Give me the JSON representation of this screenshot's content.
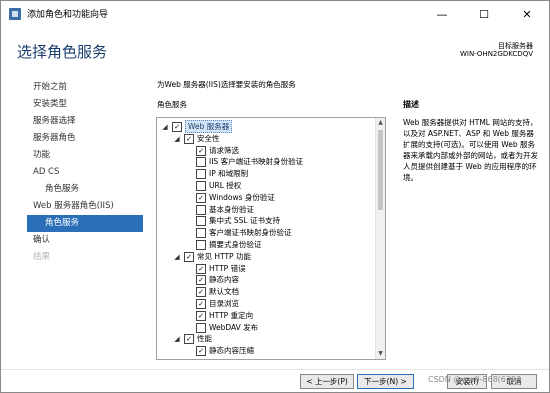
{
  "window": {
    "title": "添加角色和功能向导",
    "minimize_glyph": "—",
    "maximize_glyph": "☐",
    "close_glyph": "✕"
  },
  "header": {
    "page_title": "选择角色服务",
    "server_label": "目标服务器",
    "server_name": "WIN-OHN2GDKCDQV"
  },
  "nav": {
    "items": [
      {
        "label": "开始之前",
        "state": "normal",
        "level": 0
      },
      {
        "label": "安装类型",
        "state": "normal",
        "level": 0
      },
      {
        "label": "服务器选择",
        "state": "normal",
        "level": 0
      },
      {
        "label": "服务器角色",
        "state": "normal",
        "level": 0
      },
      {
        "label": "功能",
        "state": "normal",
        "level": 0
      },
      {
        "label": "AD CS",
        "state": "normal",
        "level": 0
      },
      {
        "label": "角色服务",
        "state": "normal",
        "level": 1
      },
      {
        "label": "Web 服务器角色(IIS)",
        "state": "normal",
        "level": 0
      },
      {
        "label": "角色服务",
        "state": "active",
        "level": 1
      },
      {
        "label": "确认",
        "state": "normal",
        "level": 0
      },
      {
        "label": "结果",
        "state": "disabled",
        "level": 0
      }
    ]
  },
  "main": {
    "intro": "为Web 服务器(IIS)选择要安装的角色服务",
    "roles_label": "角色服务",
    "tree": [
      {
        "label": "Web 服务器",
        "level": 0,
        "expandable": true,
        "checked": true,
        "selected": true
      },
      {
        "label": "安全性",
        "level": 1,
        "expandable": true,
        "checked": true
      },
      {
        "label": "请求筛选",
        "level": 2,
        "expandable": false,
        "checked": true
      },
      {
        "label": "IIS 客户端证书映射身份验证",
        "level": 2,
        "expandable": false,
        "checked": false
      },
      {
        "label": "IP 和域限制",
        "level": 2,
        "expandable": false,
        "checked": false
      },
      {
        "label": "URL 授权",
        "level": 2,
        "expandable": false,
        "checked": false
      },
      {
        "label": "Windows 身份验证",
        "level": 2,
        "expandable": false,
        "checked": true
      },
      {
        "label": "基本身份验证",
        "level": 2,
        "expandable": false,
        "checked": false
      },
      {
        "label": "集中式 SSL 证书支持",
        "level": 2,
        "expandable": false,
        "checked": false
      },
      {
        "label": "客户端证书映射身份验证",
        "level": 2,
        "expandable": false,
        "checked": false
      },
      {
        "label": "摘要式身份验证",
        "level": 2,
        "expandable": false,
        "checked": false
      },
      {
        "label": "常见 HTTP 功能",
        "level": 1,
        "expandable": true,
        "checked": true
      },
      {
        "label": "HTTP 错误",
        "level": 2,
        "expandable": false,
        "checked": true
      },
      {
        "label": "静态内容",
        "level": 2,
        "expandable": false,
        "checked": true
      },
      {
        "label": "默认文档",
        "level": 2,
        "expandable": false,
        "checked": true
      },
      {
        "label": "目录浏览",
        "level": 2,
        "expandable": false,
        "checked": true
      },
      {
        "label": "HTTP 重定向",
        "level": 2,
        "expandable": false,
        "checked": true
      },
      {
        "label": "WebDAV 发布",
        "level": 2,
        "expandable": false,
        "checked": false
      },
      {
        "label": "性能",
        "level": 1,
        "expandable": true,
        "checked": true
      },
      {
        "label": "静态内容压缩",
        "level": 2,
        "expandable": false,
        "checked": true
      }
    ],
    "description_title": "描述",
    "description_text": "Web 服务器提供对 HTML 网站的支持，以及对 ASP.NET、ASP 和 Web 服务器扩展的支持(可选)。可以使用 Web 服务器来承载内部或外部的网站，或者为开发人员提供创建基于 Web 的应用程序的环境。"
  },
  "footer": {
    "prev_label": "< 上一步(P)",
    "next_label": "下一步(N) >",
    "install_label": "安装(I)",
    "cancel_label": "取消",
    "watermark": "CSDN @ww0-868(6393"
  }
}
